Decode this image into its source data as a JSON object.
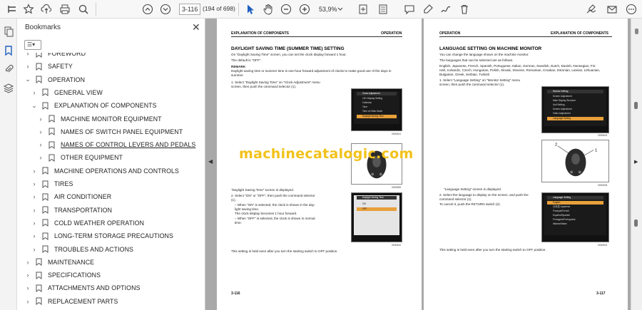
{
  "toolbar": {
    "page_current": "3-116",
    "page_count": "(194 of 698)",
    "zoom": "53,9%",
    "icons": [
      "star-icon",
      "upload-icon",
      "print-icon",
      "search-icon",
      "page-up-icon",
      "page-down-icon",
      "select-arrow-icon",
      "hand-icon",
      "zoom-out-icon",
      "zoom-in-icon",
      "zoom-dropdown-icon",
      "page-fit-icon",
      "scroll-mode-icon",
      "comment-icon",
      "highlight-icon",
      "draw-icon",
      "delete-icon",
      "sign-icon",
      "email-icon",
      "more-icon"
    ]
  },
  "bookmarks_panel": {
    "title": "Bookmarks",
    "close": "✕",
    "items": [
      {
        "label": "FOREWORD"
      },
      {
        "label": "SAFETY"
      },
      {
        "label": "OPERATION"
      },
      {
        "label": "GENERAL VIEW"
      },
      {
        "label": "EXPLANATION OF COMPONENTS"
      },
      {
        "label": "MACHINE MONITOR EQUIPMENT"
      },
      {
        "label": "NAMES OF SWITCH PANEL EQUIPMENT"
      },
      {
        "label": "NAMES OF CONTROL LEVERS AND PEDALS"
      },
      {
        "label": "OTHER EQUIPMENT"
      },
      {
        "label": "MACHINE OPERATIONS AND CONTROLS"
      },
      {
        "label": "TIRES"
      },
      {
        "label": "AIR CONDITIONER"
      },
      {
        "label": "TRANSPORTATION"
      },
      {
        "label": "COLD WEATHER OPERATION"
      },
      {
        "label": "LONG-TERM STORAGE PRECAUTIONS"
      },
      {
        "label": "TROUBLES AND ACTIONS"
      },
      {
        "label": "MAINTENANCE"
      },
      {
        "label": "SPECIFICATIONS"
      },
      {
        "label": "ATTACHMENTS AND OPTIONS"
      },
      {
        "label": "REPLACEMENT PARTS"
      }
    ]
  },
  "page_left": {
    "header_left": "EXPLANATION OF COMPONENTS",
    "header_right": "OPERATION",
    "heading": "DAYLIGHT SAVING TIME (SUMMER TIME) SETTING",
    "intro1": "On \"Daylight Saving Time\" screen, you can set the clock display forward 1 hour.",
    "intro2": "The default is \"OFF\".",
    "remark_title": "REMARK",
    "remark1": "Daylight saving time or summer time is one-hour forward adjustment of clocks to make good use of the days in",
    "remark2": "summer.",
    "step1a": "1.   Select \"Daylight Saving Time\" on \"Clock Adjustment\" menu",
    "step1b": "      screen, then push the command selector (1).",
    "screen1_title": "Clock Adjustment",
    "screen1_rows": [
      "12H Display Setting",
      "Calendar",
      "Time",
      "Time of Other Mode",
      "Daylight Saving Time"
    ],
    "screen1_vals": [
      "12H",
      "",
      "",
      ".2020",
      "OFF"
    ],
    "cap1": "0000441",
    "cap2": "0000359",
    "step_displayed": "\"Daylight Saving Time\" screen is displayed.",
    "step2a": "2.   Select \"ON\" or \"OFF\", then push the command selector",
    "step2b": "      (1).",
    "bul1a": "–   When \"ON\" is selected, the clock is shown in the day-",
    "bul1b": "     light saving time.",
    "bul1c": "     The clock display becomes 1 hour forward.",
    "bul2a": "–   When \"OFF\" is selected, the clock is shown in normal",
    "bul2b": "     time.",
    "screen2_title": "Daylight Saving Time",
    "screen2_rows": [
      "ON",
      "OFF"
    ],
    "cap3": "0000442",
    "footer_note": "This setting is held even after you turn the starting switch to OFF position.",
    "page_num": "3-116"
  },
  "page_right": {
    "header_left": "OPERATION",
    "header_right": "EXPLANATION OF COMPONENTS",
    "heading": "LANGUAGE SETTING ON MACHINE MONITOR",
    "intro1": "You can change the language shown on the machine monitor.",
    "intro2": "The languages that can be selected are as follows.",
    "langs1": "English, Japanese, French, Spanish, Portuguese, Italian, German, Swedish, Dutch, Danish, Norwegian, Fin-",
    "langs2": "nish, Icelandic, Czech, Hungarian, Polish, Slovak, Slovene, Romanian, Croatian, Estonian, Latvian, Lithuanian,",
    "langs3": "Bulgarian, Greek, Serbian, Turkish",
    "step1a": "1.   Select \"Language Setting\" on \"Monitor Setting\" menu",
    "step1b": "      screen, then push the command selector (1).",
    "screen1_title": "Monitor Setting",
    "screen1_rows": [
      "Screen Adjustment",
      "Main Display Structure",
      "Unit Setting",
      "Screen Adjustment",
      "Video Adjustment",
      "Language Setting"
    ],
    "cap1": "0000443",
    "cap2": "0000228",
    "displayed": "\"Language Setting\" screen is displayed.",
    "step2a": "2.   Select the language to display on the screen, and push the",
    "step2b": "      command selector (1).",
    "step2c": "      To cancel it, push the RETURN switch (2).",
    "screen2_title": "Language Setting",
    "screen2_rows": [
      "English",
      "日本語 Japanese",
      "Français/French",
      "Español/Spanish",
      "Português/Portuguese",
      "Italiano/Italian"
    ],
    "cap3": "0000444",
    "footer_note": "This setting is held even after you turn the starting switch to OFF position.",
    "page_num": "3-117"
  },
  "watermark": "machinecatalogic.com",
  "colors": {
    "accent": "#1f5fbf",
    "menu_highlight": "#e8a03a",
    "watermark": "#f2c21a"
  }
}
